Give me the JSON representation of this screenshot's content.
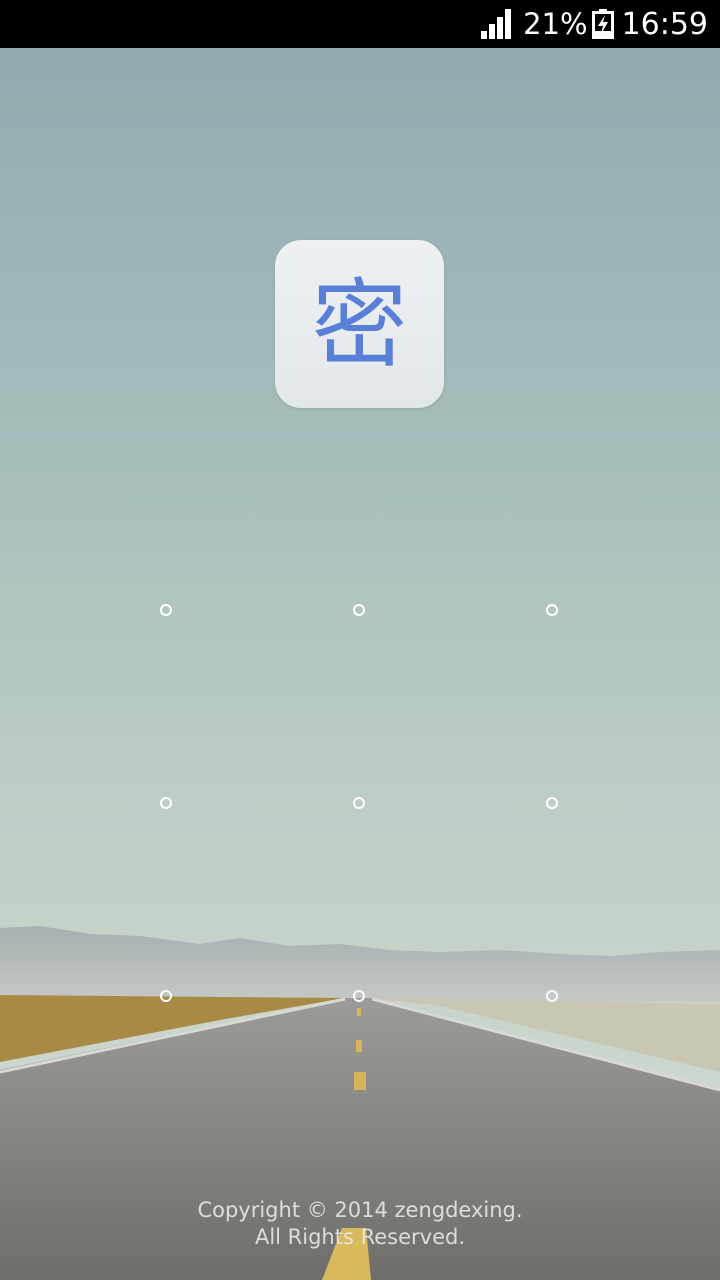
{
  "status_bar": {
    "battery_percent": "21%",
    "time": "16:59",
    "signal_icon": "signal-bars-icon",
    "battery_icon": "battery-charging-icon"
  },
  "app_icon": {
    "glyph": "密",
    "color": "#5a7fd9"
  },
  "pattern_lock": {
    "rows": 3,
    "cols": 3,
    "dot_color": "#ffffff"
  },
  "footer": {
    "line1": "Copyright © 2014 zengdexing.",
    "line2": "All Rights Reserved."
  }
}
